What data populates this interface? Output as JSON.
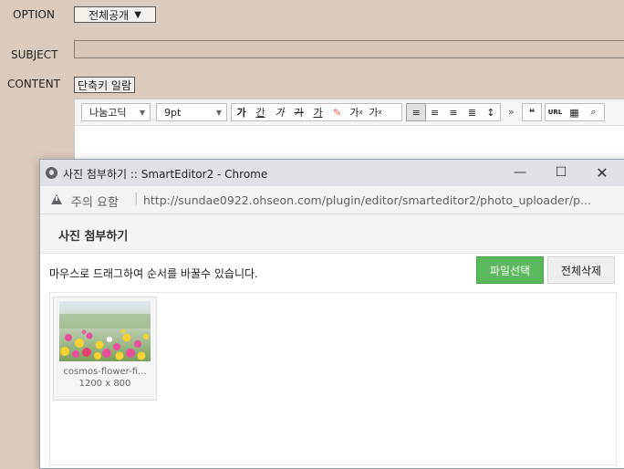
{
  "form": {
    "option_label": "OPTION",
    "option_value": "전체공개",
    "subject_label": "SUBJECT",
    "content_label": "CONTENT",
    "shortcut_button": "단축키 일람"
  },
  "editor": {
    "font_family": "나눔고딕",
    "font_size": "9pt",
    "buttons": [
      "가",
      "간",
      "가",
      "가",
      "가",
      "가",
      "가",
      "가"
    ],
    "url_label": "URL",
    "more_label": "»",
    "quote_label": "❝"
  },
  "popup": {
    "window_title": "사진 첨부하기 :: SmartEditor2 - Chrome",
    "address_warning": "주의 요함",
    "address_url": "http://sundae0922.ohseon.com/plugin/editor/smarteditor2/photo_uploader/p...",
    "header_title": "사진 첨부하기",
    "help_text": "마우스로 드래그하여 순서를 바꿀수 있습니다.",
    "file_select_button": "파일선택",
    "delete_all_button": "전체삭제",
    "thumbnail": {
      "filename": "cosmos-flower-fi...",
      "dimensions": "1200 x 800"
    }
  },
  "colors": {
    "page_bg": "#dccbbc",
    "accent_green": "#5cb85c"
  }
}
